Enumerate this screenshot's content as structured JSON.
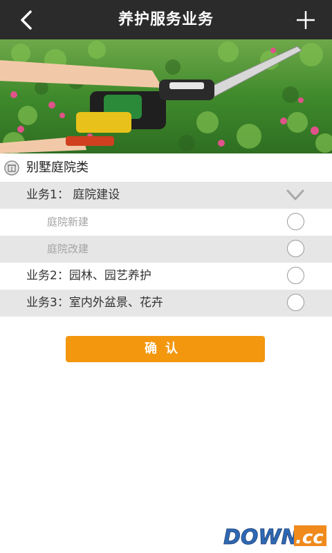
{
  "header": {
    "title": "养护服务业务",
    "back_icon": "chevron-left-icon",
    "add_icon": "plus-icon"
  },
  "banner": {
    "image": "hedge-trimmer-garden-photo"
  },
  "category": {
    "icon": "building-icon",
    "label": "别墅庭院类"
  },
  "services": [
    {
      "label": "业务1：  庭院建设",
      "expanded": true,
      "control": "chevron-down-icon"
    },
    {
      "label": "庭院新建",
      "sub": true,
      "selected": false
    },
    {
      "label": "庭院改建",
      "sub": true,
      "selected": false
    },
    {
      "label": "业务2：园林、园艺养护",
      "selected": false
    },
    {
      "label": "业务3：室内外盆景、花卉",
      "selected": false
    }
  ],
  "confirm_label": "确认",
  "watermark": {
    "text_main": "DOWN",
    "text_suffix": ".cc"
  },
  "colors": {
    "header_bg": "#2b2b2b",
    "row_alt_bg": "#e6e6e6",
    "confirm_bg": "#f3970f",
    "watermark_blue": "#2f68b4",
    "watermark_orange": "#f08a1c"
  }
}
